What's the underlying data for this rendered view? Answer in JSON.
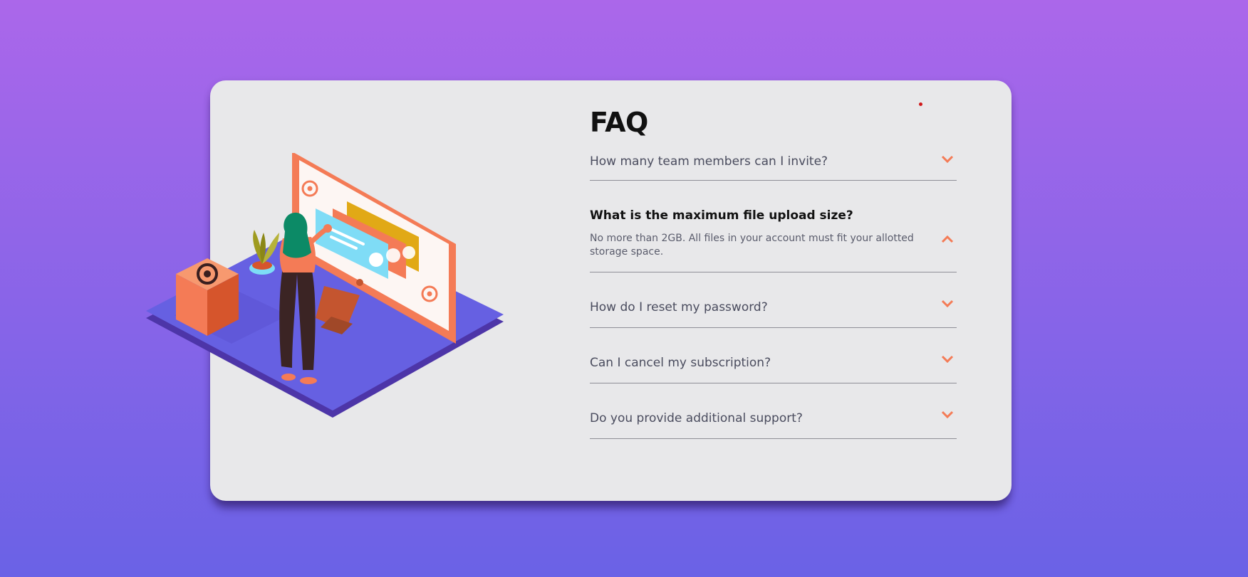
{
  "faq": {
    "title": "FAQ",
    "items": [
      {
        "question": "How many team members can I invite?",
        "expanded": false
      },
      {
        "question": "What is the maximum file upload size?",
        "expanded": true,
        "answer": "No more than 2GB. All files in your account must fit your allotted storage space."
      },
      {
        "question": "How do I reset my password?",
        "expanded": false
      },
      {
        "question": "Can I cancel my subscription?",
        "expanded": false
      },
      {
        "question": "Do you provide additional support?",
        "expanded": false
      }
    ]
  },
  "icons": {
    "collapsed": "chevron-down-icon",
    "expanded": "chevron-up-icon"
  },
  "colors": {
    "background_top": "#ab67ea",
    "background_bottom": "#6a62e6",
    "card": "#e8e8ea",
    "accent": "#f47b56",
    "heading": "#121212",
    "question": "#4a4c5e",
    "answer": "#5a5c6c",
    "divider": "#8e8e96"
  }
}
